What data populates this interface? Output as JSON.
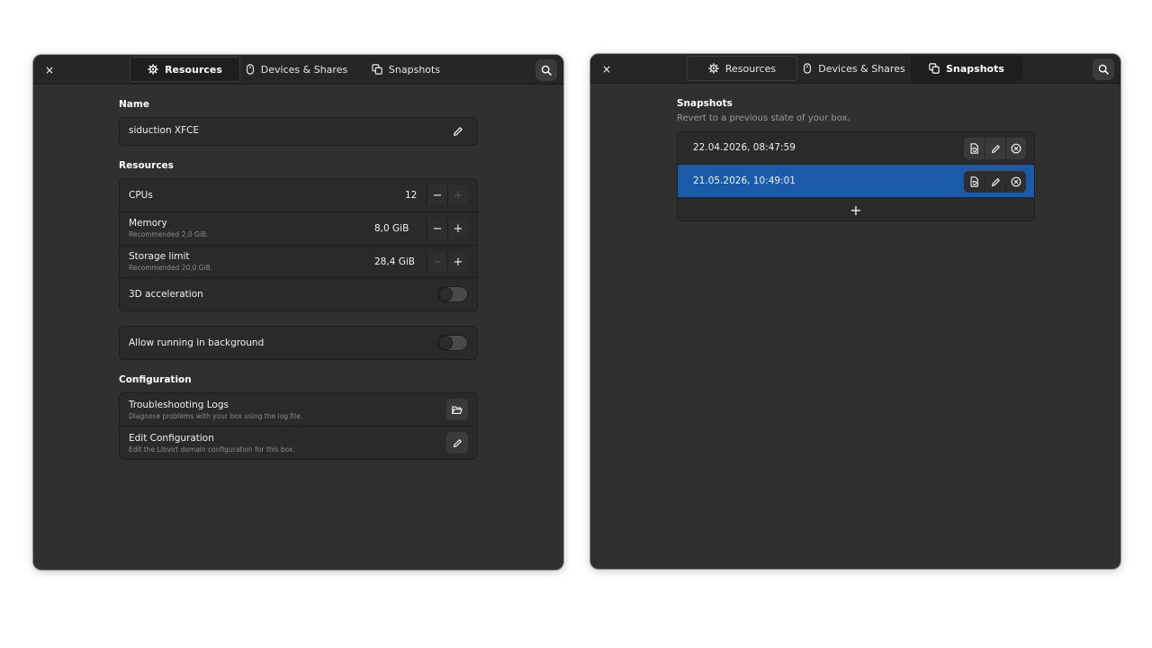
{
  "left_window": {
    "close_glyph": "×",
    "tabs": [
      {
        "label": "Resources",
        "icon": "gear-icon",
        "active": true
      },
      {
        "label": "Devices & Shares",
        "icon": "mouse-icon",
        "active": false
      },
      {
        "label": "Snapshots",
        "icon": "snapshots-icon",
        "active": false
      }
    ],
    "name_section": {
      "title": "Name",
      "value": "siduction XFCE"
    },
    "resources_section": {
      "title": "Resources",
      "cpus": {
        "label": "CPUs",
        "value": "12"
      },
      "memory": {
        "label": "Memory",
        "sub": "Recommended 2,0 GiB.",
        "value": "8,0 GiB"
      },
      "storage": {
        "label": "Storage limit",
        "sub": "Recommended 20,0 GiB.",
        "value": "28,4 GiB"
      },
      "accel": {
        "label": "3D acceleration",
        "enabled": false
      }
    },
    "background": {
      "label": "Allow running in background",
      "enabled": false
    },
    "configuration_section": {
      "title": "Configuration",
      "logs": {
        "label": "Troubleshooting Logs",
        "sub": "Diagnose problems with your box using the log file."
      },
      "edit": {
        "label": "Edit Configuration",
        "sub": "Edit the Libvirt domain configuration for this box."
      }
    }
  },
  "right_window": {
    "close_glyph": "×",
    "tabs": [
      {
        "label": "Resources",
        "icon": "gear-icon",
        "active": false
      },
      {
        "label": "Devices & Shares",
        "icon": "mouse-icon",
        "active": false
      },
      {
        "label": "Snapshots",
        "icon": "snapshots-icon",
        "active": true
      }
    ],
    "snapshots_section": {
      "title": "Snapshots",
      "subtitle": "Revert to a previous state of your box.",
      "items": [
        {
          "label": "22.04.2026, 08:47:59",
          "selected": false
        },
        {
          "label": "21.05.2026, 10:49:01",
          "selected": true
        }
      ],
      "add_glyph": "+"
    }
  },
  "glyphs": {
    "minus": "−",
    "plus": "+"
  },
  "colors": {
    "window_bg": "#303030",
    "headerbar_bg": "#262626",
    "selected_row": "#1b5aa8"
  }
}
